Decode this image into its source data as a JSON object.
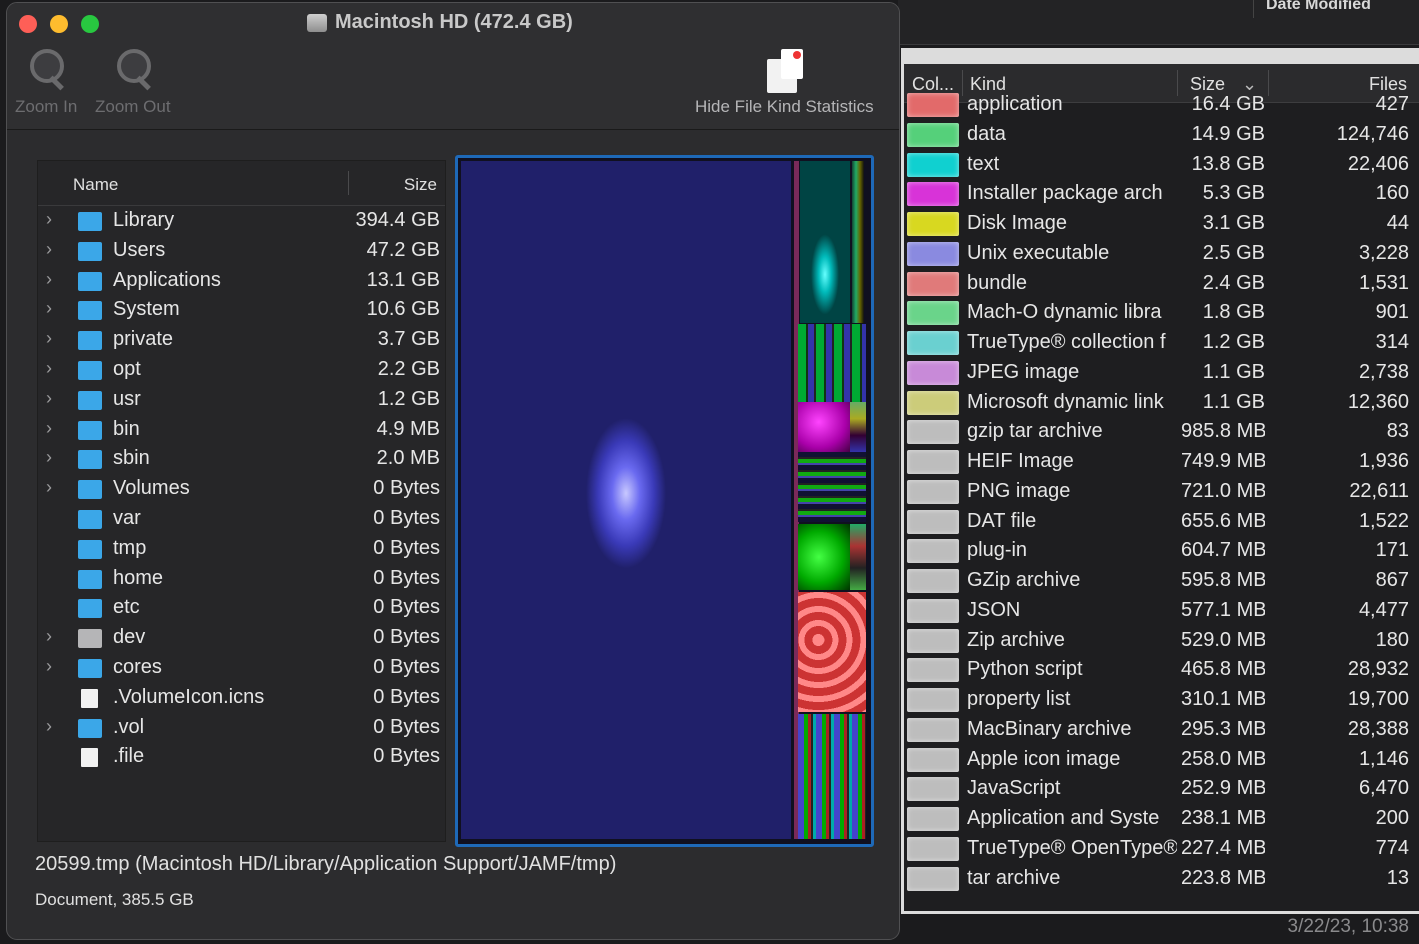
{
  "background_window": {
    "column_header": "Date Modified",
    "date_value": "3/22/23, 10:38"
  },
  "window": {
    "title": "Macintosh HD (472.4 GB)"
  },
  "toolbar": {
    "zoom_in": "Zoom In",
    "zoom_out": "Zoom Out",
    "hide_stats": "Hide File Kind Statistics"
  },
  "outline": {
    "headers": {
      "name": "Name",
      "size": "Size"
    },
    "rows": [
      {
        "name": "Library",
        "size": "394.4 GB",
        "chevron": true,
        "icon": "folder-icon"
      },
      {
        "name": "Users",
        "size": "47.2 GB",
        "chevron": true,
        "icon": "users-folder-icon"
      },
      {
        "name": "Applications",
        "size": "13.1 GB",
        "chevron": true,
        "icon": "applications-folder-icon"
      },
      {
        "name": "System",
        "size": "10.6 GB",
        "chevron": true,
        "icon": "folder-icon"
      },
      {
        "name": "private",
        "size": "3.7 GB",
        "chevron": true,
        "icon": "folder-icon"
      },
      {
        "name": "opt",
        "size": "2.2 GB",
        "chevron": true,
        "icon": "folder-icon"
      },
      {
        "name": "usr",
        "size": "1.2 GB",
        "chevron": true,
        "icon": "folder-icon"
      },
      {
        "name": "bin",
        "size": "4.9 MB",
        "chevron": true,
        "icon": "folder-icon"
      },
      {
        "name": "sbin",
        "size": "2.0 MB",
        "chevron": true,
        "icon": "folder-icon"
      },
      {
        "name": "Volumes",
        "size": "0 Bytes",
        "chevron": true,
        "icon": "folder-icon"
      },
      {
        "name": "var",
        "size": "0 Bytes",
        "chevron": false,
        "icon": "alias-folder-icon"
      },
      {
        "name": "tmp",
        "size": "0 Bytes",
        "chevron": false,
        "icon": "alias-folder-icon"
      },
      {
        "name": "home",
        "size": "0 Bytes",
        "chevron": false,
        "icon": "network-folder-icon"
      },
      {
        "name": "etc",
        "size": "0 Bytes",
        "chevron": false,
        "icon": "alias-folder-icon"
      },
      {
        "name": "dev",
        "size": "0 Bytes",
        "chevron": true,
        "icon": "disk-icon"
      },
      {
        "name": "cores",
        "size": "0 Bytes",
        "chevron": true,
        "icon": "folder-icon"
      },
      {
        "name": ".VolumeIcon.icns",
        "size": "0 Bytes",
        "chevron": false,
        "icon": "icns-file-icon"
      },
      {
        "name": ".vol",
        "size": "0 Bytes",
        "chevron": true,
        "icon": "folder-icon"
      },
      {
        "name": ".file",
        "size": "0 Bytes",
        "chevron": false,
        "icon": "file-icon"
      }
    ]
  },
  "status": {
    "path": "20599.tmp (Macintosh HD/Library/Application Support/JAMF/tmp)",
    "info": "Document, 385.5 GB"
  },
  "kinds": {
    "headers": {
      "color": "Col...",
      "kind": "Kind",
      "size": "Size",
      "files": "Files"
    },
    "rows": [
      {
        "color": "#e26a6a",
        "kind": "application",
        "size": "16.4 GB",
        "files": "427"
      },
      {
        "color": "#55d07a",
        "kind": "data",
        "size": "14.9 GB",
        "files": "124,746"
      },
      {
        "color": "#10d0d0",
        "kind": "text",
        "size": "13.8 GB",
        "files": "22,406"
      },
      {
        "color": "#d833d8",
        "kind": "Installer package arch",
        "size": "5.3 GB",
        "files": "160"
      },
      {
        "color": "#d8d820",
        "kind": "Disk Image",
        "size": "3.1 GB",
        "files": "44"
      },
      {
        "color": "#8a8ae0",
        "kind": "Unix executable",
        "size": "2.5 GB",
        "files": "3,228"
      },
      {
        "color": "#e07a7a",
        "kind": "bundle",
        "size": "2.4 GB",
        "files": "1,531"
      },
      {
        "color": "#6ad48a",
        "kind": "Mach-O dynamic libra",
        "size": "1.8 GB",
        "files": "901"
      },
      {
        "color": "#6ad0d0",
        "kind": "TrueType® collection f",
        "size": "1.2 GB",
        "files": "314"
      },
      {
        "color": "#c88ad8",
        "kind": "JPEG image",
        "size": "1.1 GB",
        "files": "2,738"
      },
      {
        "color": "#cccc7a",
        "kind": "Microsoft dynamic link",
        "size": "1.1 GB",
        "files": "12,360"
      },
      {
        "color": "#bdbdbd",
        "kind": "gzip tar archive",
        "size": "985.8 MB",
        "files": "83"
      },
      {
        "color": "#bdbdbd",
        "kind": "HEIF Image",
        "size": "749.9 MB",
        "files": "1,936"
      },
      {
        "color": "#bdbdbd",
        "kind": "PNG image",
        "size": "721.0 MB",
        "files": "22,611"
      },
      {
        "color": "#bdbdbd",
        "kind": "DAT file",
        "size": "655.6 MB",
        "files": "1,522"
      },
      {
        "color": "#bdbdbd",
        "kind": "plug-in",
        "size": "604.7 MB",
        "files": "171"
      },
      {
        "color": "#bdbdbd",
        "kind": "GZip archive",
        "size": "595.8 MB",
        "files": "867"
      },
      {
        "color": "#bdbdbd",
        "kind": "JSON",
        "size": "577.1 MB",
        "files": "4,477"
      },
      {
        "color": "#bdbdbd",
        "kind": "Zip archive",
        "size": "529.0 MB",
        "files": "180"
      },
      {
        "color": "#bdbdbd",
        "kind": "Python script",
        "size": "465.8 MB",
        "files": "28,932"
      },
      {
        "color": "#bdbdbd",
        "kind": "property list",
        "size": "310.1 MB",
        "files": "19,700"
      },
      {
        "color": "#bdbdbd",
        "kind": "MacBinary archive",
        "size": "295.3 MB",
        "files": "28,388"
      },
      {
        "color": "#bdbdbd",
        "kind": "Apple icon image",
        "size": "258.0 MB",
        "files": "1,146"
      },
      {
        "color": "#bdbdbd",
        "kind": "JavaScript",
        "size": "252.9 MB",
        "files": "6,470"
      },
      {
        "color": "#bdbdbd",
        "kind": "Application and Syste",
        "size": "238.1 MB",
        "files": "200"
      },
      {
        "color": "#bdbdbd",
        "kind": "TrueType® OpenType®",
        "size": "227.4 MB",
        "files": "774"
      },
      {
        "color": "#bdbdbd",
        "kind": "tar archive",
        "size": "223.8 MB",
        "files": "13"
      }
    ]
  }
}
